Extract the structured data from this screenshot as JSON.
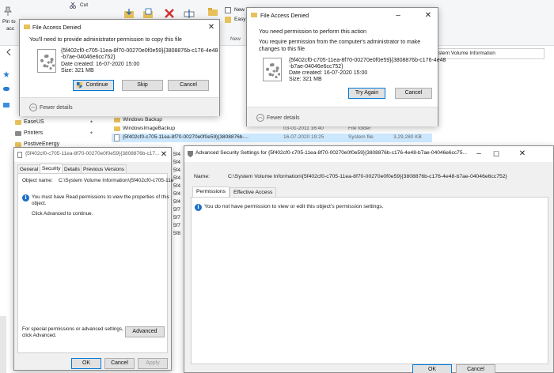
{
  "colors": {
    "accent": "#0078d7",
    "info": "#1c6fc4",
    "folder": "#e8c15a",
    "error": "#d13438"
  },
  "ribbon": {
    "pin_label": "Pin to",
    "pin_sub": "acc",
    "cut_label": "Cut",
    "new_label": "New",
    "easy_label": "Easy",
    "group_new": "New"
  },
  "addressbar": {
    "text": "stem Volume Information"
  },
  "nav": {
    "items": [
      "EaseUS",
      "Printers",
      "PostiveEnergy"
    ]
  },
  "filelist": {
    "rows": [
      {
        "name": "Windows Backup",
        "date": "",
        "type": "",
        "size": ""
      },
      {
        "name": "WindowsImageBackup",
        "date": "03-01-2011 16:40",
        "type": "File folder",
        "size": ""
      },
      {
        "name": "{5f402cf0-c705-11ea-8f70-00270e0f0e59}{3808876b-...",
        "date": "16-07-2020 19:25",
        "type": "System file",
        "size": "3,29,280 KB"
      }
    ]
  },
  "dialog_copy": {
    "title": "File Access Denied",
    "message": "You'll need to provide administrator permission to copy this file",
    "file_name_line1": "{5f402cf0-c705-11ea-8f70-00270e0f0e59}{3808876b-c176-4e48",
    "file_name_line2": "-b7ae-04046e6cc752}",
    "date_created": "Date created: 16-07-2020 15:00",
    "size": "Size: 321 MB",
    "continue_label": "Continue",
    "skip_label": "Skip",
    "cancel_label": "Cancel",
    "fewer_details": "Fewer details"
  },
  "dialog_perform": {
    "title": "File Access Denied",
    "heading": "You need permission to perform this action",
    "message_line1": "You require permission from the computer's administrator to make",
    "message_line2": "changes to this file",
    "file_name_line1": "{5f402cf0-c705-11ea-8f70-00270e0f0e59}{3808876b-c176-4e48",
    "file_name_line2": "-b7ae-04046e6cc752}",
    "date_created": "Date created: 16-07-2020 15:00",
    "size": "Size: 321 MB",
    "try_again_label": "Try Again",
    "cancel_label": "Cancel",
    "fewer_details": "Fewer details"
  },
  "properties": {
    "title": "{5f402cf0-c705-11ea-8f70-00270e0f0e59}{3808876b-c17...",
    "tabs": [
      "General",
      "Security",
      "Details",
      "Previous Versions"
    ],
    "object_label": "Object name:",
    "object_value": "C:\\System Volume Information\\{5f402cf0-c705-11e",
    "info_line1": "You must have Read permissions to view the properties of this",
    "info_line2": "object.",
    "advanced_hint": "Click Advanced to continue.",
    "special_line1": "For special permissions or advanced settings,",
    "special_line2": "click Advanced.",
    "advanced_label": "Advanced",
    "ok_label": "OK",
    "cancel_label": "Cancel",
    "apply_label": "Apply"
  },
  "advanced": {
    "title": "Advanced Security Settings for {5f402cf0-c705-11ea-8f70-00270e0f0e59}{3808876b-c176-4e48-b7ae-04046e6cc75...",
    "name_label": "Name:",
    "name_value": "C:\\System Volume Information\\{5f402cf0-c705-11ea-8f70-00270e0f0e59}{3808876b-c176-4e48-b7ae-04046e6cc752}",
    "tabs": [
      "Permissions",
      "Effective Access"
    ],
    "info": "You do not have permission to view or edit this object's permission settings.",
    "ok_label": "OK",
    "cancel_label": "Cancel"
  },
  "bg_fragments": [
    "5f4",
    "5f4",
    "5f4",
    "5f4",
    "5f4",
    "5f4",
    "5f4",
    "5f7",
    "5f7",
    "5f7",
    "5f8"
  ]
}
